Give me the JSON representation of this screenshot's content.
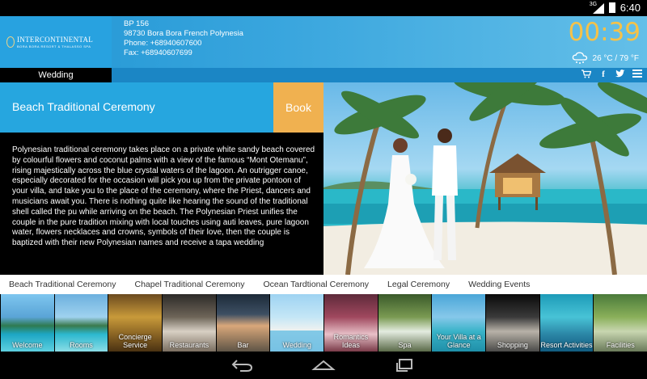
{
  "statusbar": {
    "network": "3G",
    "time": "6:40"
  },
  "header": {
    "logo_line1": "INTERCONTINENTAL",
    "logo_line2": "BORA BORA RESORT & THALASSO SPA",
    "address": [
      "BP 156",
      "98730 Bora Bora French Polynesia",
      "Phone: +68940607600",
      "Fax: +68940607699"
    ],
    "clock": "00:39",
    "weather": "26 °C / 79 °F"
  },
  "nav": {
    "active_section": "Wedding"
  },
  "page": {
    "title": "Beach Traditional Ceremony",
    "book_label": "Book",
    "description": "Polynesian traditional ceremony takes place on a private white sandy beach covered by colourful flowers and coconut palms with a view of the famous “Mont Otemanu”, rising majestically across the blue crystal waters of the lagoon. An outrigger canoe, especially decorated for the occasion will pick you up from the private pontoon of your villa, and take you to the place of the ceremony, where the Priest, dancers and musicians await you. There is nothing quite like hearing the sound of the traditional shell called the pu while arriving on the beach. The Polynesian Priest unifies the couple in the pure tradition mixing with local touches using auti leaves, pure lagoon water, flowers necklaces and crowns, symbols of their love, then the couple is baptized with their new Polynesian names and receive a tapa wedding"
  },
  "category_tabs": [
    "Beach Traditional Ceremony",
    "Chapel Traditional Ceremony",
    "Ocean Tardtional Ceremony",
    "Legal Ceremony",
    "Wedding Events"
  ],
  "thumbnails": [
    {
      "label": "Welcome",
      "bg": "linear-gradient(180deg,#7ec6ef 0%,#5aa4d6 40%,#2f7a50 55%,#1da7c4 70%,#5fd0e0 100%)"
    },
    {
      "label": "Rooms",
      "bg": "linear-gradient(180deg,#6cb0de 0%,#9fd2ef 40%,#3a7a4c 55%,#2cb8cf 70%,#8bdde6 100%)"
    },
    {
      "label": "Concierge Service",
      "bg": "linear-gradient(180deg,#6b4a1f 0%,#c89a3a 40%,#8a6424 70%,#4a3212 100%)"
    },
    {
      "label": "Restaurants",
      "bg": "linear-gradient(180deg,#2c2a28 0%,#6e6558 40%,#d8d0c4 65%,#7a6e60 100%)"
    },
    {
      "label": "Bar",
      "bg": "linear-gradient(180deg,#1c2a38 0%,#3d4f63 35%,#d9a77a 55%,#5e5446 100%)"
    },
    {
      "label": "Wedding",
      "bg": "linear-gradient(180deg,#9ed3f2 0%,#c4e6f6 40%,#f3f3f0 65%,#d8e4ea 100%)",
      "active": true
    },
    {
      "label": "Romantics Ideas",
      "bg": "linear-gradient(180deg,#5e2a3a 0%,#a0485e 40%,#e8c0c8 70%,#7a3a48 100%)"
    },
    {
      "label": "Spa",
      "bg": "linear-gradient(180deg,#3a5a2a 0%,#7a9a52 40%,#e4ece0 65%,#5a6a48 100%)"
    },
    {
      "label": "Your Villa at a Glance",
      "bg": "linear-gradient(180deg,#4aa6d8 0%,#86c8ea 40%,#39b3c8 65%,#1f8fa8 100%)"
    },
    {
      "label": "Shopping",
      "bg": "linear-gradient(180deg,#0a0a0a 0%,#3a3a3a 40%,#b8b2a8 65%,#4a4a48 100%)"
    },
    {
      "label": "Resort Activities",
      "bg": "linear-gradient(180deg,#1d9bb8 0%,#48c3d6 40%,#2b86a6 70%,#125c80 100%)"
    },
    {
      "label": "Facilities",
      "bg": "linear-gradient(180deg,#4a7a3a 0%,#8ab05a 40%,#c8d6b0 65%,#6a7a5a 100%)"
    }
  ],
  "colors": {
    "accent": "#26a6df",
    "book": "#f0b150",
    "clock": "#f6c248"
  }
}
